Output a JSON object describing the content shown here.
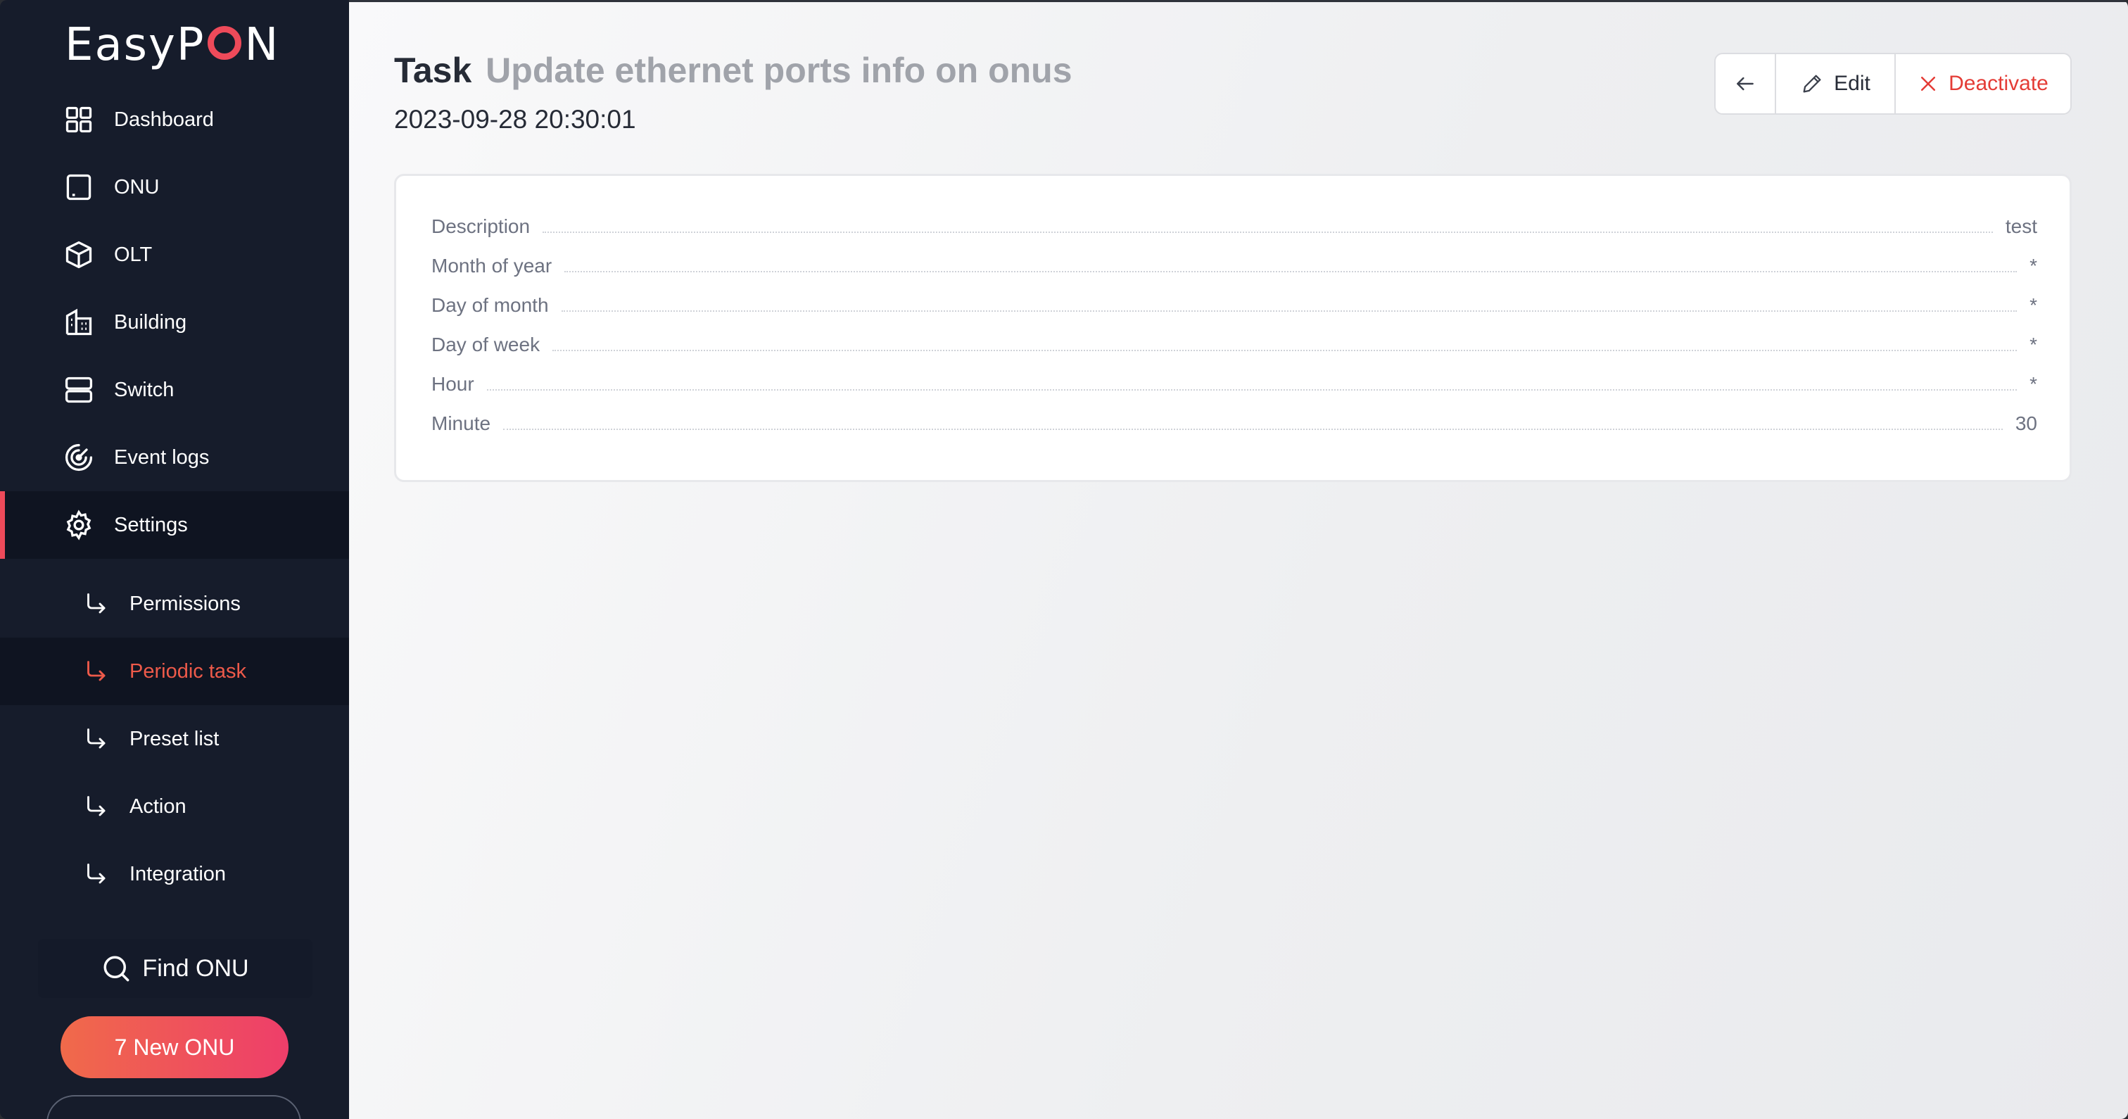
{
  "brand": {
    "logo_pre": "EasyP",
    "logo_post": "N"
  },
  "sidebar": {
    "items": [
      {
        "label": "Dashboard"
      },
      {
        "label": "ONU"
      },
      {
        "label": "OLT"
      },
      {
        "label": "Building"
      },
      {
        "label": "Switch"
      },
      {
        "label": "Event logs"
      },
      {
        "label": "Settings"
      }
    ],
    "subitems": [
      {
        "label": "Permissions"
      },
      {
        "label": "Periodic task"
      },
      {
        "label": "Preset list"
      },
      {
        "label": "Action"
      },
      {
        "label": "Integration"
      }
    ],
    "find_onu": "Find ONU",
    "new_onu": "7 New ONU"
  },
  "header": {
    "title": "Task",
    "subtitle": "Update ethernet ports info on onus",
    "date": "2023-09-28 20:30:01",
    "edit_label": "Edit",
    "deactivate_label": "Deactivate"
  },
  "details": [
    {
      "key": "Description",
      "value": "test"
    },
    {
      "key": "Month of year",
      "value": "*"
    },
    {
      "key": "Day of month",
      "value": "*"
    },
    {
      "key": "Day of week",
      "value": "*"
    },
    {
      "key": "Hour",
      "value": "*"
    },
    {
      "key": "Minute",
      "value": "30"
    }
  ],
  "colors": {
    "accent": "#ee4a5a",
    "sidebar_bg": "#161c2b",
    "danger": "#e43c36"
  }
}
